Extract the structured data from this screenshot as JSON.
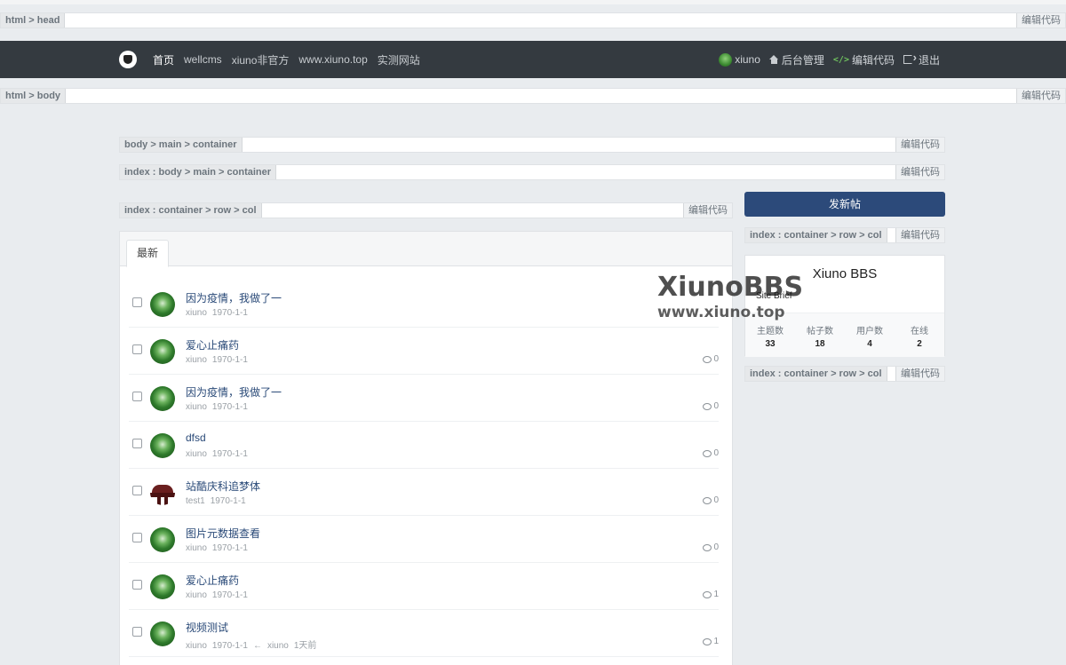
{
  "code_bars": {
    "head_label": "html > head",
    "body_label": "html > body",
    "main_container_label": "body > main > container",
    "index_main_label": "index : body > main > container",
    "col_left_label": "index : container > row > col",
    "col_right1_label": "index : container > row > col",
    "col_right2_label": "index : container > row > col",
    "edit_label": "编辑代码"
  },
  "navbar": {
    "links": [
      "首页",
      "wellcms",
      "xiuno非官方",
      "www.xiuno.top",
      "实测网站"
    ],
    "user": "xiuno",
    "admin": "后台管理",
    "edit_code": "编辑代码",
    "logout": "退出"
  },
  "threads_tab": "最新",
  "threads": [
    {
      "title": "因为疫情，我做了一",
      "user": "xiuno",
      "date": "1970-1-1",
      "replies": ""
    },
    {
      "title": "爱心止痛药",
      "user": "xiuno",
      "date": "1970-1-1",
      "replies": "0"
    },
    {
      "title": "因为疫情，我做了一",
      "user": "xiuno",
      "date": "1970-1-1",
      "replies": "0"
    },
    {
      "title": "dfsd",
      "user": "xiuno",
      "date": "1970-1-1",
      "replies": "0"
    },
    {
      "title": "站酷庆科追梦体",
      "user": "test1",
      "date": "1970-1-1",
      "replies": "0"
    },
    {
      "title": "图片元数据查看",
      "user": "xiuno",
      "date": "1970-1-1",
      "replies": "0"
    },
    {
      "title": "爱心止痛药",
      "user": "xiuno",
      "date": "1970-1-1",
      "replies": "1"
    },
    {
      "title": "视频测试",
      "user": "xiuno",
      "date": "1970-1-1",
      "replies": "1",
      "last_arrow": "←",
      "last_user": "xiuno",
      "last_time": "1天前"
    }
  ],
  "sidebar": {
    "new_post": "发新帖",
    "site_name": "Xiuno BBS",
    "site_brief": "Site Brief",
    "stats": [
      {
        "label": "主题数",
        "value": "33"
      },
      {
        "label": "帖子数",
        "value": "18"
      },
      {
        "label": "用户数",
        "value": "4"
      },
      {
        "label": "在线",
        "value": "2"
      }
    ]
  },
  "watermark": {
    "line1": "XiunoBBS",
    "line2": "www.xiuno.top"
  }
}
